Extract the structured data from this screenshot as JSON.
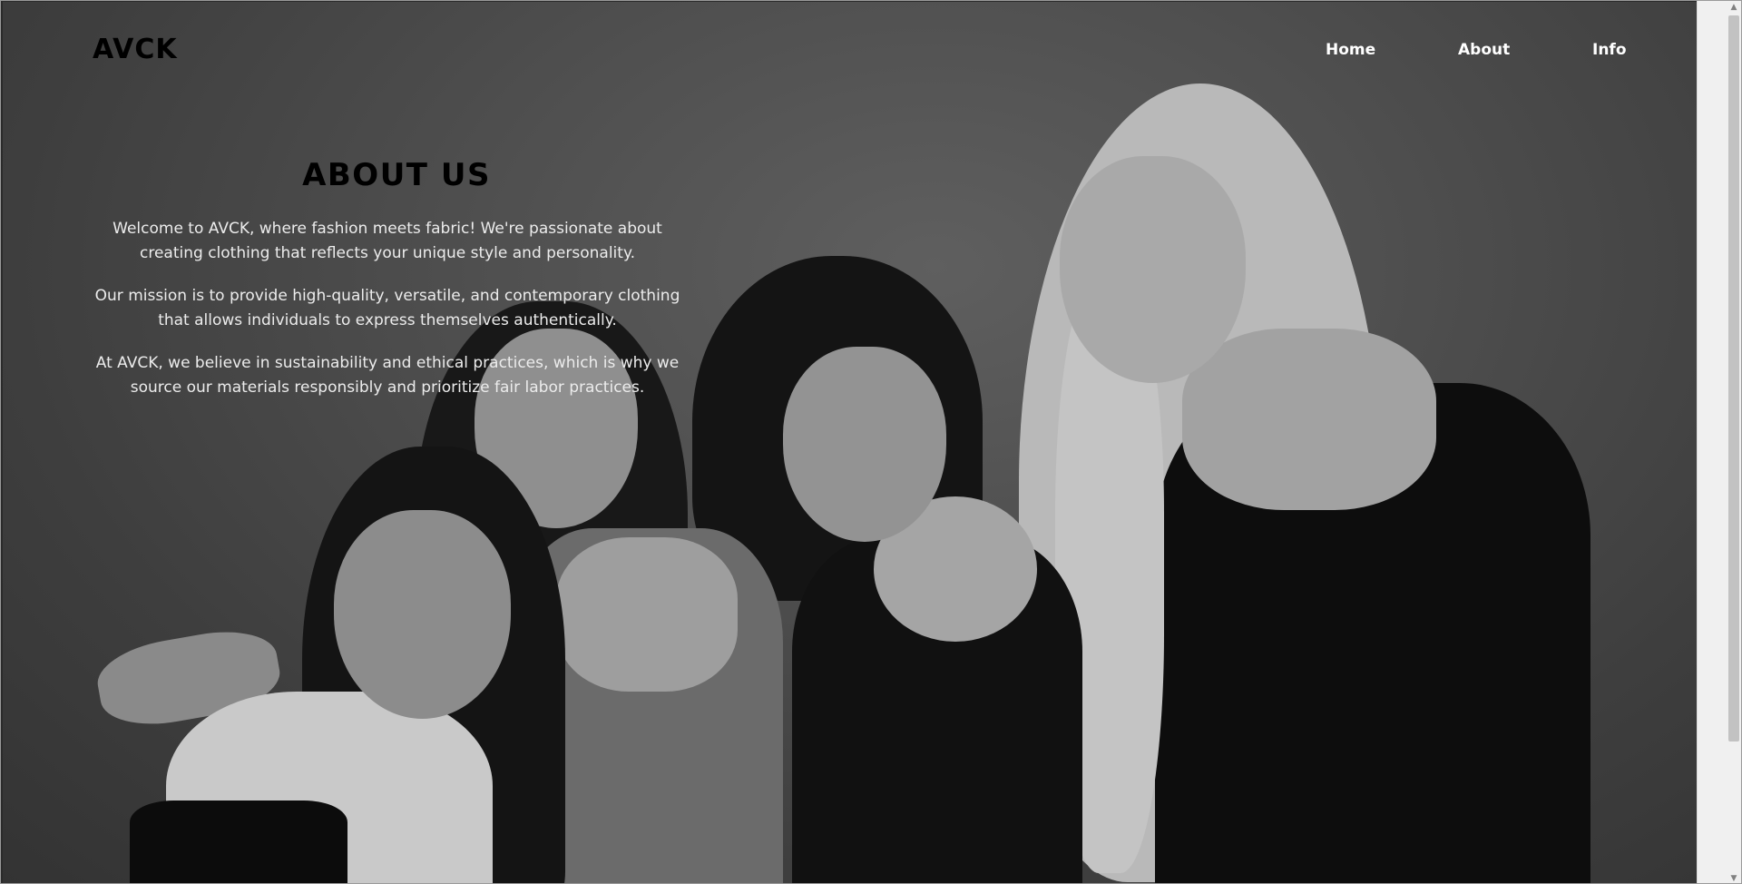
{
  "header": {
    "logo": "AVCK",
    "nav": {
      "home": "Home",
      "about": "About",
      "info": "Info"
    }
  },
  "about": {
    "title": "ABOUT US",
    "paragraphs": [
      "Welcome to AVCK, where fashion meets fabric! We're passionate about creating clothing that reflects your unique style and personality.",
      "Our mission is to provide high-quality, versatile, and contemporary clothing that allows individuals to express themselves authentically.",
      "At AVCK, we believe in sustainability and ethical practices, which is why we source our materials responsibly and prioritize fair labor practices."
    ]
  },
  "icons": {
    "scroll_up": "scroll-up-arrow-icon",
    "scroll_down": "scroll-down-arrow-icon"
  },
  "colors": {
    "nav_text": "#ffffff",
    "title_text": "#000000",
    "body_text": "#ececec"
  }
}
